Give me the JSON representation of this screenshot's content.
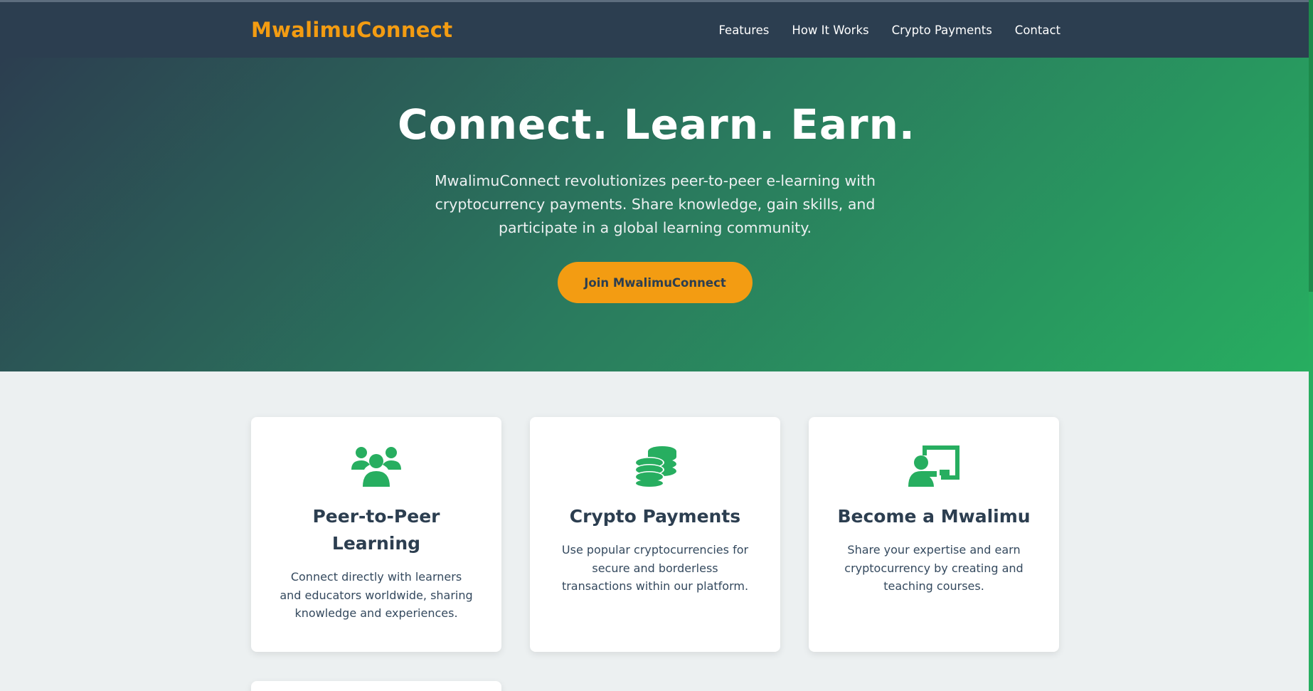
{
  "nav": {
    "logo": "MwalimuConnect",
    "links": [
      "Features",
      "How It Works",
      "Crypto Payments",
      "Contact"
    ]
  },
  "hero": {
    "title": "Connect. Learn. Earn.",
    "description": "MwalimuConnect revolutionizes peer-to-peer e-learning with cryptocurrency payments. Share knowledge, gain skills, and participate in a global learning community.",
    "cta_label": "Join MwalimuConnect"
  },
  "features": [
    {
      "icon": "users-icon",
      "title": "Peer-to-Peer Learning",
      "description": "Connect directly with learners and educators worldwide, sharing knowledge and experiences."
    },
    {
      "icon": "coins-icon",
      "title": "Crypto Payments",
      "description": "Use popular cryptocurrencies for secure and borderless transactions within our platform."
    },
    {
      "icon": "chalkboard-teacher-icon",
      "title": "Become a Mwalimu",
      "description": "Share your expertise and earn cryptocurrency by creating and teaching courses."
    }
  ],
  "colors": {
    "navy": "#2c3e50",
    "green": "#27ae60",
    "orange": "#f39c12",
    "background": "#ecf0f1"
  }
}
